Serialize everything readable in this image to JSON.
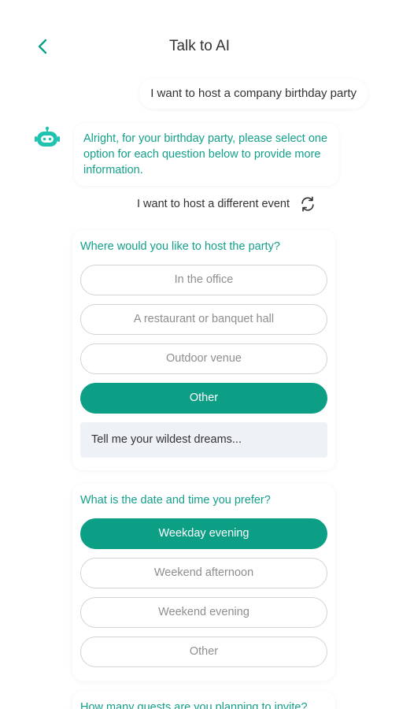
{
  "header": {
    "title": "Talk to AI",
    "back_icon": "chevron-left-icon"
  },
  "chat": {
    "user_message": "I want to host a company birthday party",
    "bot_message": "Alright, for your birthday party, please select one option for each question below to provide more information.",
    "different_event_label": "I want to host a different event",
    "refresh_icon": "refresh-icon",
    "bot_icon": "robot-icon"
  },
  "questions": [
    {
      "question": "Where would you like to host the party?",
      "options": [
        "In the office",
        "A restaurant or banquet hall",
        "Outdoor venue",
        "Other"
      ],
      "selected": "Other",
      "input_value": "Tell me your wildest dreams..."
    },
    {
      "question": "What is the date and time you prefer?",
      "options": [
        "Weekday evening",
        "Weekend afternoon",
        "Weekend evening",
        "Other"
      ],
      "selected": "Weekday evening"
    },
    {
      "question": "How many guests are you planning to invite?"
    }
  ],
  "colors": {
    "accent": "#0d9e86",
    "accent_text": "#13a08a",
    "input_bg": "#eef2f7"
  }
}
